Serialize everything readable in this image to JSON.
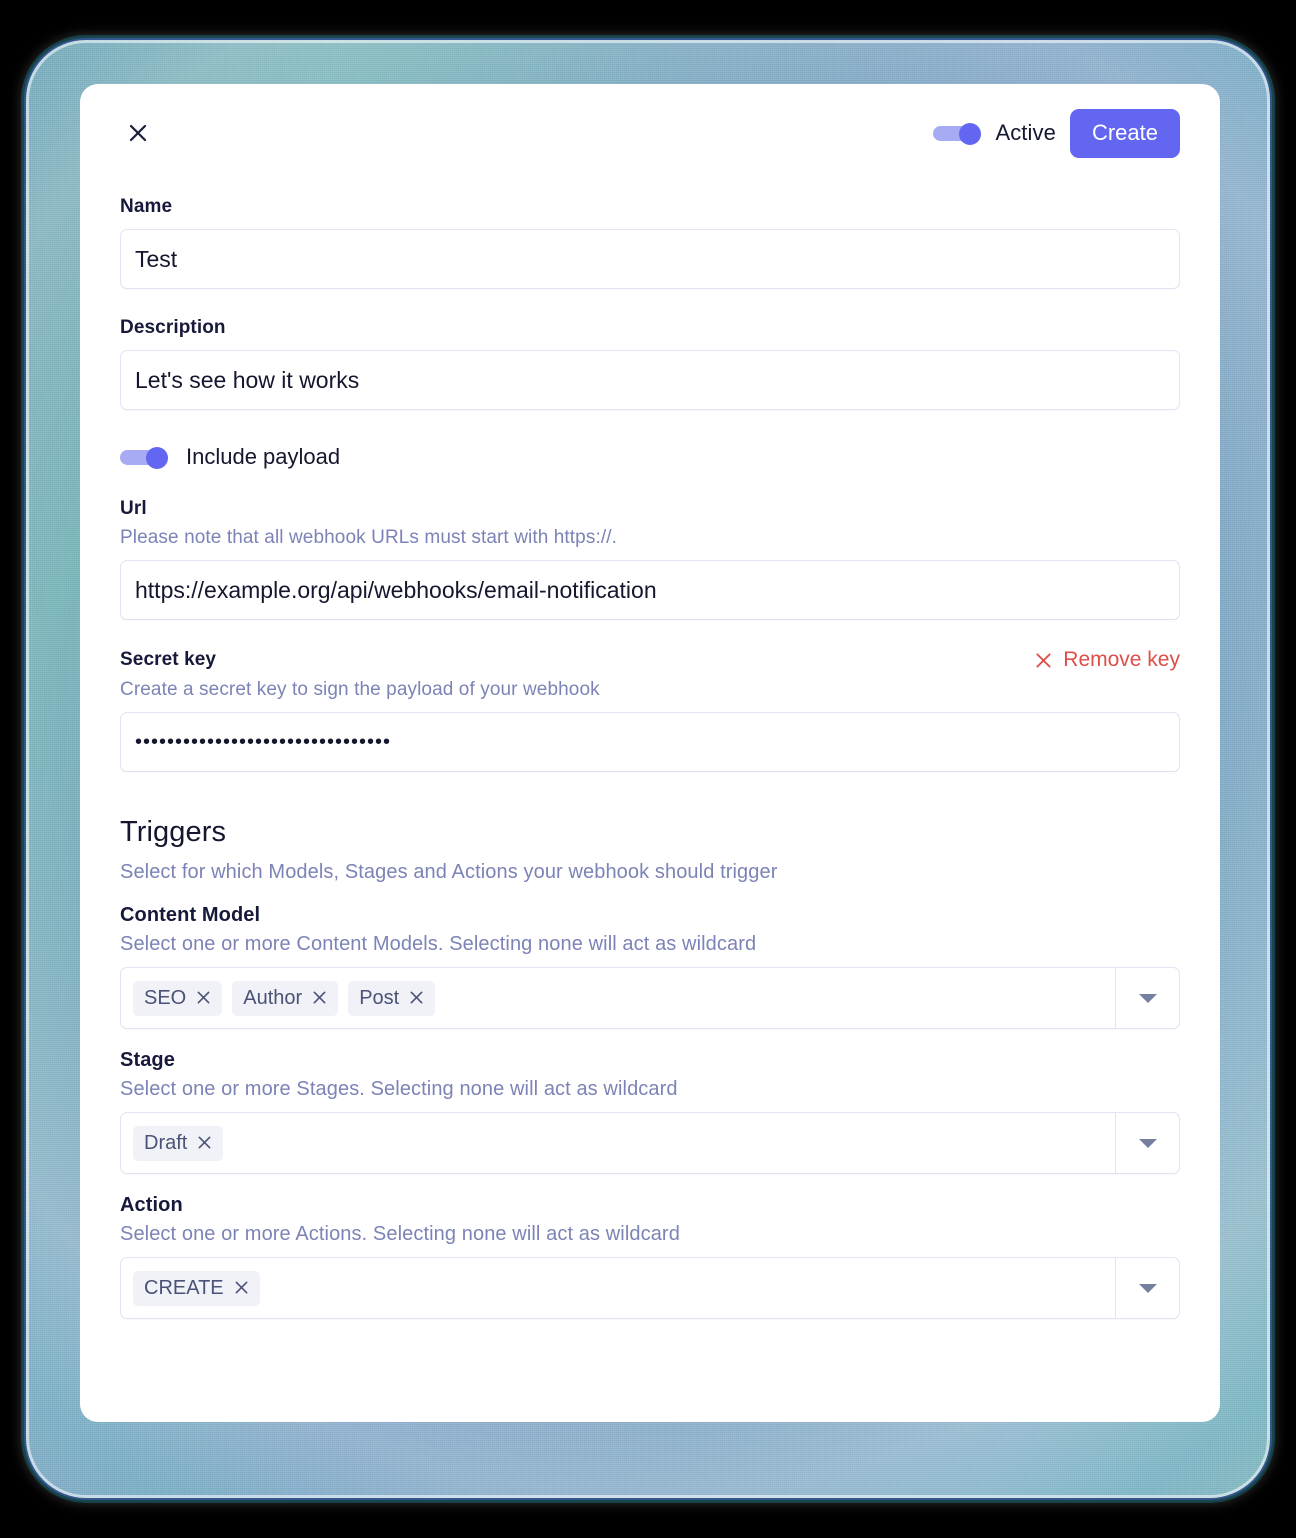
{
  "header": {
    "close_icon": "close-icon",
    "active_toggle_label": "Active",
    "active_toggle_state": "on",
    "create_label": "Create"
  },
  "form": {
    "name": {
      "label": "Name",
      "value": "Test",
      "placeholder": ""
    },
    "description": {
      "label": "Description",
      "value": "Let's see how it works",
      "placeholder": ""
    },
    "include_payload": {
      "label": "Include payload",
      "state": "on"
    },
    "url": {
      "label": "Url",
      "help": "Please note that all webhook URLs must start with https://.",
      "value": "https://example.org/api/webhooks/email-notification",
      "placeholder": ""
    },
    "secret_key": {
      "label": "Secret key",
      "remove_label": "Remove key",
      "remove_icon": "close-icon",
      "help": "Create a secret key to sign the payload of your webhook",
      "value": "••••••••••••••••••••••••••••••••",
      "placeholder": ""
    }
  },
  "triggers": {
    "title": "Triggers",
    "subtitle": "Select for which Models, Stages and Actions your webhook should trigger",
    "groups": [
      {
        "label": "Content Model",
        "help": "Select one or more Content Models. Selecting none will act as wildcard",
        "chips": [
          "SEO",
          "Author",
          "Post"
        ]
      },
      {
        "label": "Stage",
        "help": "Select one or more Stages. Selecting none will act as wildcard",
        "chips": [
          "Draft"
        ]
      },
      {
        "label": "Action",
        "help": "Select one or more Actions. Selecting none will act as wildcard",
        "chips": [
          "CREATE"
        ]
      }
    ]
  },
  "colors": {
    "accent": "#6366F1",
    "toggle_track": "#A7ABF4",
    "danger": "#DD4F49",
    "text": "#14172E",
    "muted_text": "#7C83B6",
    "border": "#E2E3F3",
    "chip_bg": "#F1F2F7",
    "chip_text": "#4A5277",
    "backdrop": "#7FA5C0"
  }
}
